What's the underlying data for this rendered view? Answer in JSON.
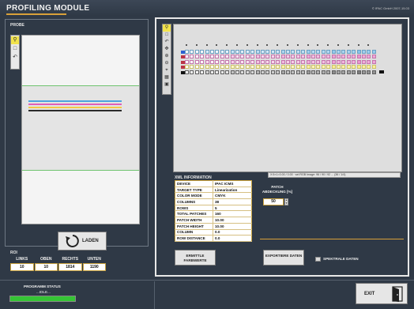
{
  "header": {
    "title": "PROFILING MODULE",
    "copyright": "© IPAC GmbH 2007-15.03"
  },
  "probe": {
    "label": "PROBE",
    "tools": [
      "search-icon",
      "rectangle-icon",
      "undo-icon"
    ],
    "load_label": "LADEN"
  },
  "roi": {
    "label": "ROI",
    "fields": [
      {
        "label": "LINKS",
        "value": "10"
      },
      {
        "label": "OBEN",
        "value": "10"
      },
      {
        "label": "RECHTS",
        "value": "1814"
      },
      {
        "label": "UNTEN",
        "value": "1190"
      }
    ]
  },
  "chart": {
    "status_text": "X:5×1=0.00 / 0.00 · sel RGB Image: 96 / 90 / 92 ... (36 / 1/4)",
    "patch_colors": {
      "cyan": "#4aa3df",
      "magenta": "#e05fb8",
      "yellow": "#f3e14a",
      "black": "#3a3a3a",
      "white": "#ffffff"
    }
  },
  "xml": {
    "title": "XML INFORMATION",
    "rows": [
      {
        "k": "DEVICE",
        "v": "IPAC ICMS"
      },
      {
        "k": "TARGET TYPE",
        "v": "Linearization"
      },
      {
        "k": "COLOR MODE",
        "v": "CMYK"
      },
      {
        "k": "COLUMNS",
        "v": "38"
      },
      {
        "k": "ROWS",
        "v": "5"
      },
      {
        "k": "TOTAL PATCHES",
        "v": "160"
      },
      {
        "k": "PATCH WIDTH",
        "v": "10.00"
      },
      {
        "k": "PATCH HEIGHT",
        "v": "10.00"
      },
      {
        "k": "COLUMN",
        "v": "0.0"
      },
      {
        "k": "ROW DISTANCE",
        "v": "0.0"
      }
    ]
  },
  "coverage": {
    "label": "PATCH ABDECKUNG [%]",
    "value": "50"
  },
  "actions": {
    "farbwerte": "ERMITTLE FARBWERTE",
    "export": "EXPORTIERE DATEN",
    "spektral": "SPEKTRALE DATEN"
  },
  "program": {
    "label": "PROGRAMM STATUS",
    "status": "...IDLE...",
    "progress": 1.0
  },
  "exit_label": "EXIT"
}
